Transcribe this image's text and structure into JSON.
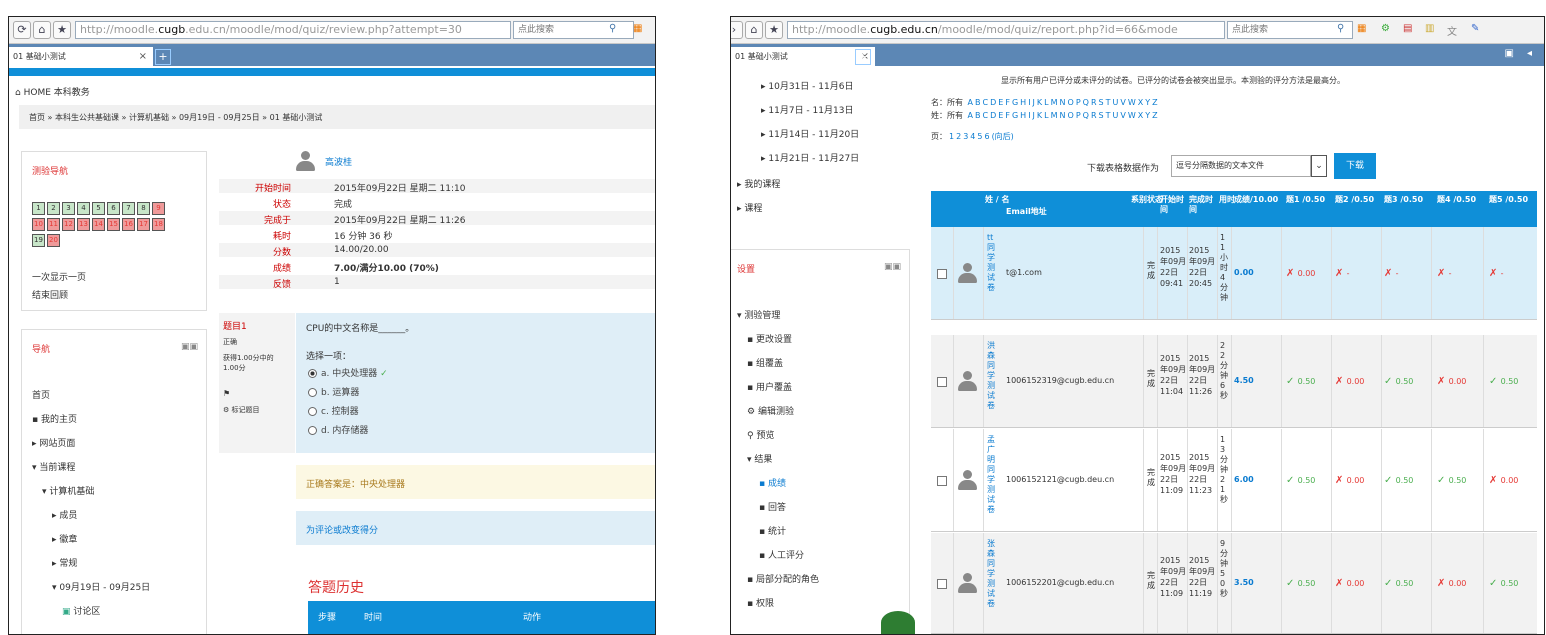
{
  "left": {
    "url_prefix": "http://moodle.",
    "url_domain": "cugb",
    "url_suffix": ".edu.cn/moodle/mod/quiz/review.php?attempt=30",
    "search_placeholder": "点此搜索",
    "tab_title": "01 基础小测试",
    "home_label": "HOME",
    "home_extra": "本科教务",
    "breadcrumb": "首页 » 本科生公共基础课 » 计算机基础 » 09月19日 - 09月25日 » 01 基础小测试",
    "quiz_nav": {
      "title": "测验导航",
      "questions": [
        "1",
        "2",
        "3",
        "4",
        "5",
        "6",
        "7",
        "8",
        "9",
        "10",
        "11",
        "12",
        "13",
        "14",
        "15",
        "16",
        "17",
        "18",
        "19",
        "20"
      ],
      "show_one": "一次显示一页",
      "finish": "结束回顾"
    },
    "navigation": {
      "title": "导航",
      "items": [
        "首页",
        "我的主页",
        "网站页面",
        "当前课程",
        "计算机基础",
        "成员",
        "徽章",
        "常规",
        "09月19日 - 09月25日",
        "讨论区"
      ]
    },
    "summary": {
      "user": "高波桂",
      "rows": [
        {
          "label": "开始时间",
          "value": "2015年09月22日 星期二 11:10"
        },
        {
          "label": "状态",
          "value": "完成"
        },
        {
          "label": "完成于",
          "value": "2015年09月22日 星期二 11:26"
        },
        {
          "label": "耗时",
          "value": "16 分钟 36 秒"
        },
        {
          "label": "分数",
          "value": "14.00/20.00"
        },
        {
          "label": "成绩",
          "value": "7.00/满分10.00 (70%)"
        },
        {
          "label": "反馈",
          "value": "1"
        }
      ]
    },
    "question": {
      "number_label": "题目1",
      "state": "正确",
      "mark": "获得1.00分中的1.00分",
      "flag": "标记题目",
      "text": "CPU的中文名称是______。",
      "prompt": "选择一项：",
      "options": [
        "a. 中央处理器",
        "b. 运算器",
        "c. 控制器",
        "d. 内存储器"
      ],
      "right_answer": "正确答案是：中央处理器",
      "comment": "为评论或改变得分"
    },
    "history": {
      "title": "答题历史",
      "headers": [
        "步骤",
        "时间",
        "动作"
      ]
    }
  },
  "right": {
    "url_prefix": "http://moodle.",
    "url_domain": "cugb.edu.cn",
    "url_suffix": "/moodle/mod/quiz/report.php?id=66&mode",
    "search_placeholder": "点此搜索",
    "tab_title": "01 基础小测试",
    "tree_top": [
      "10月31日 - 11月6日",
      "11月7日 - 11月13日",
      "11月14日 - 11月20日",
      "11月21日 - 11月27日",
      "我的课程",
      "课程"
    ],
    "settings_title": "设置",
    "settings_items": [
      "测验管理",
      "更改设置",
      "组覆盖",
      "用户覆盖",
      "编辑测验",
      "预览",
      "结果",
      "成绩",
      "回答",
      "统计",
      "人工评分",
      "局部分配的角色",
      "权限"
    ],
    "notice": "显示所有用户已评分或未评分的试卷。已评分的试卷会被突出显示。本测验的评分方法是最高分。",
    "first_name_label": "名：所有",
    "last_name_label": "姓：所有",
    "letters": [
      "A",
      "B",
      "C",
      "D",
      "E",
      "F",
      "G",
      "H",
      "I",
      "J",
      "K",
      "L",
      "M",
      "N",
      "O",
      "P",
      "Q",
      "R",
      "S",
      "T",
      "U",
      "V",
      "W",
      "X",
      "Y",
      "Z"
    ],
    "pages_label": "页：",
    "pages": [
      "1",
      "2",
      "3",
      "4",
      "5",
      "6",
      "(向后)"
    ],
    "download_label": "下载表格数据作为",
    "download_format": "逗号分隔数据的文本文件",
    "download_button": "下载",
    "headers": [
      "姓 / 名",
      "Email地址",
      "系别",
      "状态",
      "开始时间",
      "完成时间",
      "用时",
      "成绩/10.00",
      "题1 /0.50",
      "题2 /0.50",
      "题3 /0.50",
      "题4 /0.50",
      "题5 /0.50"
    ],
    "rows": [
      {
        "name": "tt同学测试卷",
        "email": "t@1.com",
        "state": "完成",
        "start": "2015年09月22日09:41",
        "end": "2015年09月22日20:45",
        "time": "11小时4分钟",
        "grade": "0.00",
        "q": [
          [
            "bad",
            "0.00"
          ],
          [
            "bad",
            "-"
          ],
          [
            "bad",
            "-"
          ],
          [
            "bad",
            "-"
          ],
          [
            "bad",
            "-"
          ]
        ]
      },
      {
        "name": "洪森同学测试卷",
        "email": "1006152319@cugb.edu.cn",
        "state": "完成",
        "start": "2015年09月22日11:04",
        "end": "2015年09月22日11:26",
        "time": "22分钟6秒",
        "grade": "4.50",
        "q": [
          [
            "ok",
            "0.50"
          ],
          [
            "bad",
            "0.00"
          ],
          [
            "ok",
            "0.50"
          ],
          [
            "bad",
            "0.00"
          ],
          [
            "ok",
            "0.50"
          ]
        ]
      },
      {
        "name": "孟广明同学测试卷",
        "email": "1006152121@cugb.deu.cn",
        "state": "完成",
        "start": "2015年09月22日11:09",
        "end": "2015年09月22日11:23",
        "time": "13分钟21秒",
        "grade": "6.00",
        "q": [
          [
            "ok",
            "0.50"
          ],
          [
            "bad",
            "0.00"
          ],
          [
            "ok",
            "0.50"
          ],
          [
            "ok",
            "0.50"
          ],
          [
            "bad",
            "0.00"
          ]
        ]
      },
      {
        "name": "张森同学测试卷",
        "email": "1006152201@cugb.edu.cn",
        "state": "完成",
        "start": "2015年09月22日11:09",
        "end": "2015年09月22日11:19",
        "time": "9分钟50秒",
        "grade": "3.50",
        "q": [
          [
            "ok",
            "0.50"
          ],
          [
            "bad",
            "0.00"
          ],
          [
            "ok",
            "0.50"
          ],
          [
            "bad",
            "0.00"
          ],
          [
            "ok",
            "0.50"
          ]
        ]
      }
    ]
  },
  "colors": {
    "blue": "#0f8fd8",
    "tabbar": "#5c87b5",
    "red": "#d32f2f",
    "green": "#4caf50"
  }
}
